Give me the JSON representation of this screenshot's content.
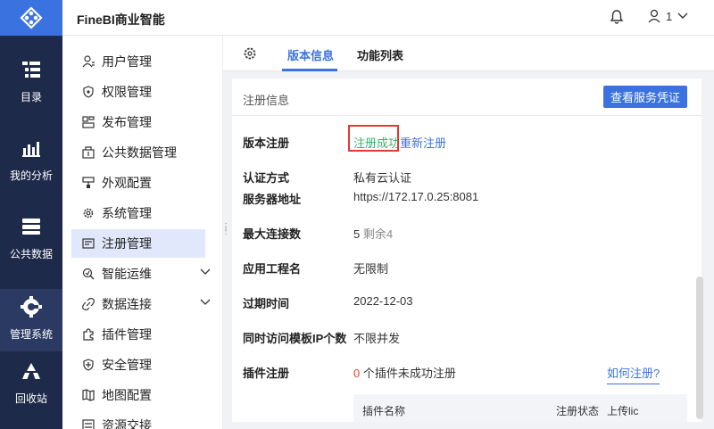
{
  "app": {
    "title": "FineBI商业智能"
  },
  "header": {
    "user_label": "1"
  },
  "rail": [
    {
      "label": "目录",
      "icon": "catalog-icon"
    },
    {
      "label": "我的分析",
      "icon": "analysis-icon"
    },
    {
      "label": "公共数据",
      "icon": "public-data-icon"
    },
    {
      "label": "管理系统",
      "icon": "manage-system-icon"
    },
    {
      "label": "回收站",
      "icon": "recycle-icon"
    }
  ],
  "submenu": [
    {
      "label": "用户管理",
      "icon": "user-icon"
    },
    {
      "label": "权限管理",
      "icon": "shield-icon"
    },
    {
      "label": "发布管理",
      "icon": "publish-icon"
    },
    {
      "label": "公共数据管理",
      "icon": "public-data-manage-icon"
    },
    {
      "label": "外观配置",
      "icon": "brush-icon"
    },
    {
      "label": "系统管理",
      "icon": "gear-icon"
    },
    {
      "label": "注册管理",
      "icon": "register-icon",
      "active": true
    },
    {
      "label": "智能运维",
      "icon": "ops-icon",
      "expandable": true
    },
    {
      "label": "数据连接",
      "icon": "link-icon",
      "expandable": true
    },
    {
      "label": "插件管理",
      "icon": "plugin-icon"
    },
    {
      "label": "安全管理",
      "icon": "security-icon"
    },
    {
      "label": "地图配置",
      "icon": "map-icon"
    },
    {
      "label": "资源交接",
      "icon": "handover-icon"
    }
  ],
  "tabs": [
    {
      "label": "版本信息",
      "active": true
    },
    {
      "label": "功能列表",
      "active": false
    }
  ],
  "section": {
    "title": "注册信息",
    "view_cert_button": "查看服务凭证"
  },
  "info": {
    "version_reg": {
      "label": "版本注册",
      "status": "注册成功",
      "re_register": "重新注册"
    },
    "auth_method": {
      "label": "认证方式",
      "value": "私有云认证"
    },
    "server_addr": {
      "label": "服务器地址",
      "value": "https://172.17.0.25:8081"
    },
    "max_conn": {
      "label": "最大连接数",
      "value": "5",
      "remaining": "剩余4"
    },
    "project_name": {
      "label": "应用工程名",
      "value": "无限制"
    },
    "expire": {
      "label": "过期时间",
      "value": "2022-12-03"
    },
    "concurrent_ip": {
      "label": "同时访问模板IP个数",
      "value": "不限并发"
    },
    "plugin_reg": {
      "label": "插件注册",
      "count": "0",
      "suffix": " 个插件未成功注册",
      "how_link": "如何注册?"
    }
  },
  "plugin_table": {
    "headers": [
      "插件名称",
      "注册状态",
      "上传lic"
    ]
  },
  "colors": {
    "accent": "#3a73e0",
    "rail": "#1e2a4a",
    "success": "#3bb36a",
    "danger": "#e8402e"
  }
}
